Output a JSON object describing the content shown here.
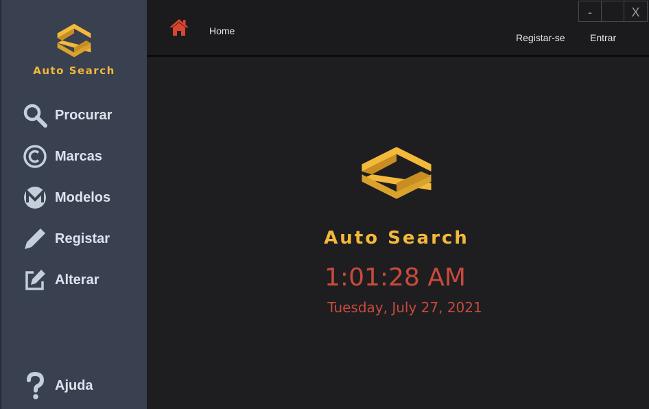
{
  "app": {
    "logo_text": "Auto Search",
    "accent_color": "#f3b93a",
    "clock_color": "#c94a3d"
  },
  "sidebar": {
    "items": [
      {
        "label": "Procurar",
        "icon": "search-icon"
      },
      {
        "label": "Marcas",
        "icon": "copyright-icon"
      },
      {
        "label": "Modelos",
        "icon": "monero-icon"
      },
      {
        "label": "Registar",
        "icon": "pencil-icon"
      },
      {
        "label": "Alterar",
        "icon": "edit-icon"
      }
    ],
    "help": {
      "label": "Ajuda",
      "icon": "question-icon"
    }
  },
  "topbar": {
    "home_label": "Home",
    "register_label": "Registar-se",
    "login_label": "Entrar"
  },
  "window_controls": {
    "minimize": "-",
    "maximize": "",
    "close": "X"
  },
  "main": {
    "title": "Auto Search",
    "time": "1:01:28 AM",
    "date": "Tuesday, July 27, 2021"
  }
}
